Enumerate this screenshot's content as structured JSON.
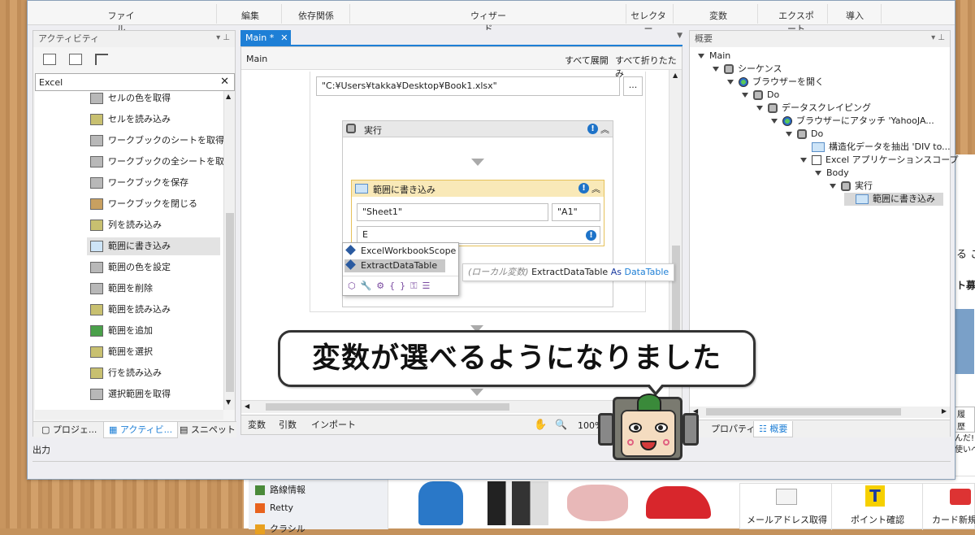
{
  "ribbon": {
    "items": [
      "ファイル",
      "編集",
      "依存関係",
      "ウィザード",
      "セレクター",
      "変数",
      "エクスポート",
      "導入"
    ]
  },
  "activities": {
    "title": "アクティビティ",
    "search_value": "Excel",
    "items": [
      "セルの色を取得",
      "セルを読み込み",
      "ワークブックのシートを取得",
      "ワークブックの全シートを取得",
      "ワークブックを保存",
      "ワークブックを閉じる",
      "列を読み込み",
      "範囲に書き込み",
      "範囲の色を設定",
      "範囲を削除",
      "範囲を読み込み",
      "範囲を追加",
      "範囲を選択",
      "行を読み込み",
      "選択範囲を取得"
    ],
    "selected_index": 7,
    "bottom_tabs": [
      "プロジェ...",
      "アクティビ...",
      "スニペット"
    ]
  },
  "designer": {
    "tab_label": "Main *",
    "breadcrumb": "Main",
    "expand_all": "すべて展開",
    "collapse_all": "すべて折りたたみ",
    "path_value": "\"C:¥Users¥takka¥Desktop¥Book1.xlsx\"",
    "browse_label": "...",
    "seq_title": "実行",
    "write_title": "範囲に書き込み",
    "sheet_value": "\"Sheet1\"",
    "cell_value": "\"A1\"",
    "input_value": "E",
    "autocomplete": [
      "ExcelWorkbookScope",
      "ExtractDataTable"
    ],
    "autocomplete_selected": 1,
    "tooltip": {
      "prefix": "(ローカル変数)",
      "name": "ExtractDataTable",
      "as": "As",
      "type": "DataTable"
    },
    "bottom_tabs": [
      "変数",
      "引数",
      "インポート"
    ],
    "zoom": "100%"
  },
  "outline": {
    "title": "概要",
    "nodes": [
      {
        "label": "Main",
        "level": 0
      },
      {
        "label": "シーケンス",
        "level": 1
      },
      {
        "label": "ブラウザーを開く",
        "level": 2
      },
      {
        "label": "Do",
        "level": 3
      },
      {
        "label": "データスクレイピング",
        "level": 4
      },
      {
        "label": "ブラウザーにアタッチ 'YahooJA...",
        "level": 5
      },
      {
        "label": "Do",
        "level": 6
      },
      {
        "label": "構造化データを抽出 'DIV  to...",
        "level": 7
      },
      {
        "label": "Excel アプリケーションスコープ",
        "level": 7
      },
      {
        "label": "Body",
        "level": 8
      },
      {
        "label": "実行",
        "level": 9
      },
      {
        "label": "範囲に書き込み",
        "level": 10
      }
    ],
    "bottom_tabs": [
      "プロパティ",
      "概要"
    ]
  },
  "output_label": "出力",
  "caption": "変数が選べるようになりました",
  "background_page": {
    "links": [
      "路線情報",
      "Retty",
      "クラシル"
    ],
    "buttons": [
      "メールアドレス取得",
      "ポイント確認",
      "カード新規"
    ],
    "edge_text": [
      "る こ",
      "ト募",
      "履歴",
      "んだ!",
      "使いへ"
    ]
  },
  "colors": {
    "accent": "#1e7fd6",
    "selected": "#cde4f7",
    "card_header": "#f9e9b8",
    "card_border": "#e6c15a"
  }
}
